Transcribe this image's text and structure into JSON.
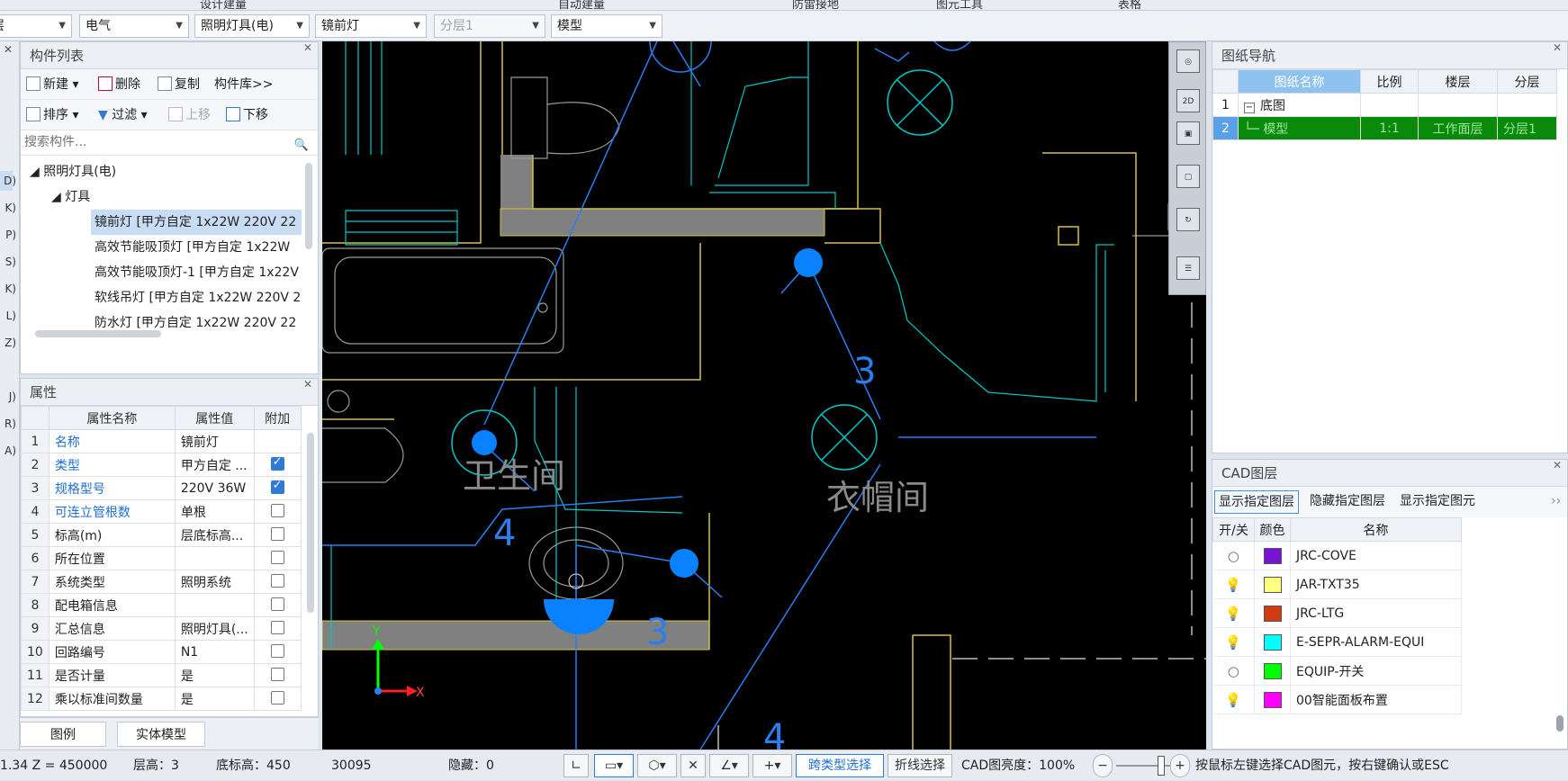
{
  "top_tabs": [
    "设计建量",
    "自动建量",
    "防雷接地",
    "图元工具",
    "表格"
  ],
  "selectors": [
    {
      "value": "首层",
      "disabled": false
    },
    {
      "value": "电气",
      "disabled": false
    },
    {
      "value": "照明灯具(电)",
      "disabled": false
    },
    {
      "value": "镜前灯",
      "disabled": false
    },
    {
      "value": "分层1",
      "disabled": true
    },
    {
      "value": "模型",
      "disabled": false
    }
  ],
  "left_edge": [
    "D)",
    "K)",
    "P)",
    "S)",
    "K)",
    "L)",
    "Z)",
    "",
    "J)",
    "R)",
    "A)"
  ],
  "component_list": {
    "title": "构件列表",
    "toolbar": {
      "new": "新建",
      "delete": "删除",
      "copy": "复制",
      "library": "构件库>>",
      "sort": "排序",
      "filter": "过滤",
      "up": "上移",
      "down": "下移"
    },
    "search_placeholder": "搜索构件...",
    "tree": {
      "root": "照明灯具(电)",
      "group": "灯具",
      "items": [
        "镜前灯 [甲方自定 1x22W 220V 22",
        "高效节能吸顶灯 [甲方自定 1x22W",
        "高效节能吸顶灯-1 [甲方自定 1x22V",
        "软线吊灯 [甲方自定 1x22W 220V 2",
        "防水灯 [甲方自定 1x22W 220V 22"
      ]
    }
  },
  "properties": {
    "title": "属性",
    "headers": [
      "属性名称",
      "属性值",
      "附加"
    ],
    "rows": [
      {
        "no": "1",
        "name": "名称",
        "value": "镜前灯",
        "blue": true,
        "check": "none"
      },
      {
        "no": "2",
        "name": "类型",
        "value": "甲方自定 ...",
        "blue": true,
        "check": "on"
      },
      {
        "no": "3",
        "name": "规格型号",
        "value": "220V 36W",
        "blue": true,
        "check": "on"
      },
      {
        "no": "4",
        "name": "可连立管根数",
        "value": "单根",
        "blue": true,
        "check": "off"
      },
      {
        "no": "5",
        "name": "标高(m)",
        "value": "层底标高...",
        "blue": false,
        "check": "off"
      },
      {
        "no": "6",
        "name": "所在位置",
        "value": "",
        "blue": false,
        "check": "off"
      },
      {
        "no": "7",
        "name": "系统类型",
        "value": "照明系统",
        "blue": false,
        "check": "off"
      },
      {
        "no": "8",
        "name": "配电箱信息",
        "value": "",
        "blue": false,
        "check": "off"
      },
      {
        "no": "9",
        "name": "汇总信息",
        "value": "照明灯具(...",
        "blue": false,
        "check": "off"
      },
      {
        "no": "10",
        "name": "回路编号",
        "value": "N1",
        "blue": false,
        "check": "off"
      },
      {
        "no": "11",
        "name": "是否计量",
        "value": "是",
        "blue": false,
        "check": "off"
      },
      {
        "no": "12",
        "name": "乘以标准间数量",
        "value": "是",
        "blue": false,
        "check": "off"
      }
    ]
  },
  "bottom_tabs": [
    "图例",
    "实体模型"
  ],
  "drawing_nav": {
    "title": "图纸导航",
    "headers": [
      "图纸名称",
      "比例",
      "楼层",
      "分层"
    ],
    "rows": [
      {
        "no": "1",
        "name": "底图",
        "scale": "",
        "floor": "",
        "layer": ""
      },
      {
        "no": "2",
        "name": "模型",
        "scale": "1:1",
        "floor": "工作面层",
        "layer": "分层1"
      }
    ]
  },
  "cad_layers": {
    "title": "CAD图层",
    "buttons": [
      "显示指定图层",
      "隐藏指定图层",
      "显示指定图元"
    ],
    "headers": [
      "开/关",
      "颜色",
      "名称"
    ],
    "rows": [
      {
        "on": false,
        "color": "#7a12d6",
        "name": "JRC-COVE"
      },
      {
        "on": true,
        "color": "#ffff80",
        "name": "JAR-TXT35"
      },
      {
        "on": true,
        "color": "#d23a12",
        "name": "JRC-LTG"
      },
      {
        "on": true,
        "color": "#00ffff",
        "name": "E-SEPR-ALARM-EQUI"
      },
      {
        "on": false,
        "color": "#00ff00",
        "name": "EQUIP-开关"
      },
      {
        "on": true,
        "color": "#ff00ff",
        "name": "00智能面板布置"
      }
    ]
  },
  "canvas_text": {
    "room1": "卫生间",
    "room2": "衣帽间",
    "n1": "3",
    "n2": "4",
    "n3": "3",
    "n4": "4",
    "axis_x": "X",
    "axis_y": "Y"
  },
  "vtool": {
    "mode_label": "2D"
  },
  "status": {
    "coord": "1.34 Z = 450000",
    "floor": "层高：3",
    "base": "底标高：450",
    "num": "30095",
    "hidden": "隐藏：0",
    "type_select": "跨类型选择",
    "poly_select": "折线选择",
    "brightness": "CAD图亮度：100%",
    "hint": "按鼠标左键选择CAD图元，按右键确认或ESC"
  }
}
